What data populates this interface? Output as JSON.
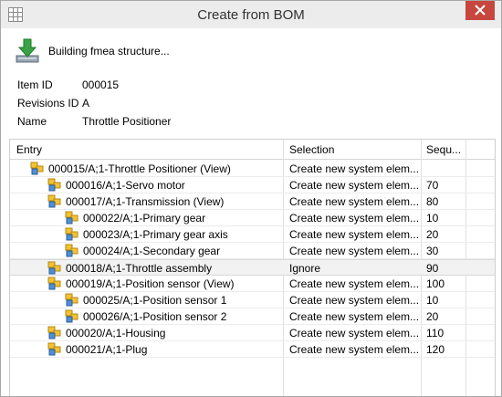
{
  "window": {
    "title": "Create from BOM"
  },
  "status": {
    "message": "Building fmea structure..."
  },
  "props": {
    "item_id_label": "Item ID",
    "item_id_value": "000015",
    "revisions_id_label": "Revisions ID",
    "revisions_id_value": "A",
    "name_label": "Name",
    "name_value": "Throttle Positioner"
  },
  "grid": {
    "columns": {
      "entry": "Entry",
      "selection": "Selection",
      "sequence": "Sequ..."
    },
    "rows": [
      {
        "entry": "000015/A;1-Throttle Positioner (View)",
        "selection": "Create new system elem...",
        "sequence": "",
        "level": 0,
        "selected": false
      },
      {
        "entry": "000016/A;1-Servo motor",
        "selection": "Create new system elem...",
        "sequence": "70",
        "level": 1,
        "selected": false
      },
      {
        "entry": "000017/A;1-Transmission (View)",
        "selection": "Create new system elem...",
        "sequence": "80",
        "level": 1,
        "selected": false
      },
      {
        "entry": "000022/A;1-Primary gear",
        "selection": "Create new system elem...",
        "sequence": "10",
        "level": 2,
        "selected": false
      },
      {
        "entry": "000023/A;1-Primary gear axis",
        "selection": "Create new system elem...",
        "sequence": "20",
        "level": 2,
        "selected": false
      },
      {
        "entry": "000024/A;1-Secondary gear",
        "selection": "Create new system elem...",
        "sequence": "30",
        "level": 2,
        "selected": false
      },
      {
        "entry": "000018/A;1-Throttle assembly",
        "selection": "Ignore",
        "sequence": "90",
        "level": 1,
        "selected": true
      },
      {
        "entry": "000019/A;1-Position sensor (View)",
        "selection": "Create new system elem...",
        "sequence": "100",
        "level": 1,
        "selected": false
      },
      {
        "entry": "000025/A;1-Position sensor 1",
        "selection": "Create new system elem...",
        "sequence": "10",
        "level": 2,
        "selected": false
      },
      {
        "entry": "000026/A;1-Position sensor 2",
        "selection": "Create new system elem...",
        "sequence": "20",
        "level": 2,
        "selected": false
      },
      {
        "entry": "000020/A;1-Housing",
        "selection": "Create new system elem...",
        "sequence": "110",
        "level": 1,
        "selected": false
      },
      {
        "entry": "000021/A;1-Plug",
        "selection": "Create new system elem...",
        "sequence": "120",
        "level": 1,
        "selected": false
      }
    ]
  },
  "icons": {
    "app": "grid-icon",
    "status": "download-arrow-icon",
    "node": "bom-item-icon",
    "close": "close-icon"
  },
  "colors": {
    "close_button": "#c7463d",
    "status_arrow": "#3aa345",
    "node_yellow": "#f2c335",
    "node_blue": "#4f8fd6",
    "selected_row": "#f2f2f2"
  }
}
